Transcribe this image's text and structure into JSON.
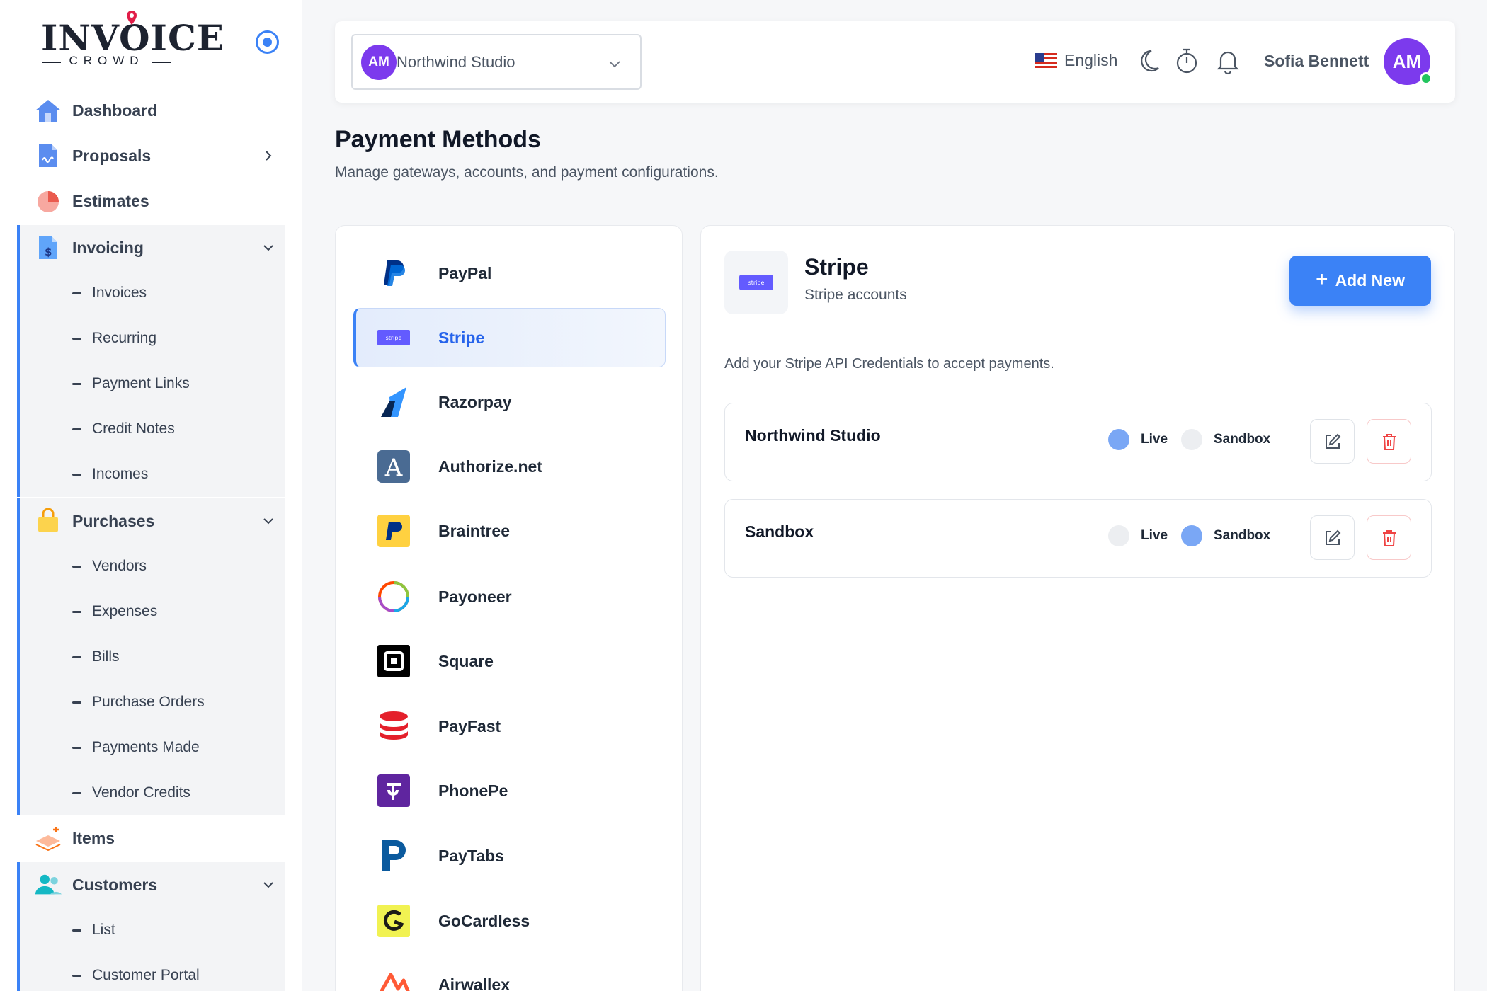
{
  "brand": {
    "logo_word": "INVOICE",
    "logo_sub": "CROWD"
  },
  "sidebar": {
    "items": [
      {
        "label": "Dashboard",
        "icon": "home-icon"
      },
      {
        "label": "Proposals",
        "icon": "document-icon"
      },
      {
        "label": "Estimates",
        "icon": "pie-chart-icon"
      }
    ],
    "invoicing": {
      "label": "Invoicing",
      "subitems": [
        "Invoices",
        "Recurring",
        "Payment Links",
        "Credit Notes",
        "Incomes"
      ]
    },
    "purchases": {
      "label": "Purchases",
      "subitems": [
        "Vendors",
        "Expenses",
        "Bills",
        "Purchase Orders",
        "Payments Made",
        "Vendor Credits"
      ]
    },
    "items_label": "Items",
    "customers": {
      "label": "Customers",
      "subitems": [
        "List",
        "Customer Portal"
      ]
    }
  },
  "header": {
    "company_initials": "AM",
    "company_name": "Northwind Studio",
    "language": "English",
    "user_name": "Sofia Bennett",
    "user_initials": "AM"
  },
  "page": {
    "title": "Payment Methods",
    "subtitle": "Manage gateways, accounts, and payment configurations."
  },
  "gateways": [
    "PayPal",
    "Stripe",
    "Razorpay",
    "Authorize.net",
    "Braintree",
    "Payoneer",
    "Square",
    "PayFast",
    "PhonePe",
    "PayTabs",
    "GoCardless",
    "Airwallex"
  ],
  "selected_gateway": "Stripe",
  "detail": {
    "title": "Stripe",
    "subtitle": "Stripe accounts",
    "add_button": "Add New",
    "note": "Add your Stripe API Credentials to accept payments.",
    "live_label": "Live",
    "sandbox_label": "Sandbox",
    "accounts": [
      {
        "name": "Northwind Studio",
        "mode": "Live"
      },
      {
        "name": "Sandbox",
        "mode": "Sandbox"
      }
    ]
  },
  "colors": {
    "accent": "#3b82f6",
    "avatar": "#7c3aed",
    "danger": "#ef4444",
    "online": "#22c55e"
  }
}
